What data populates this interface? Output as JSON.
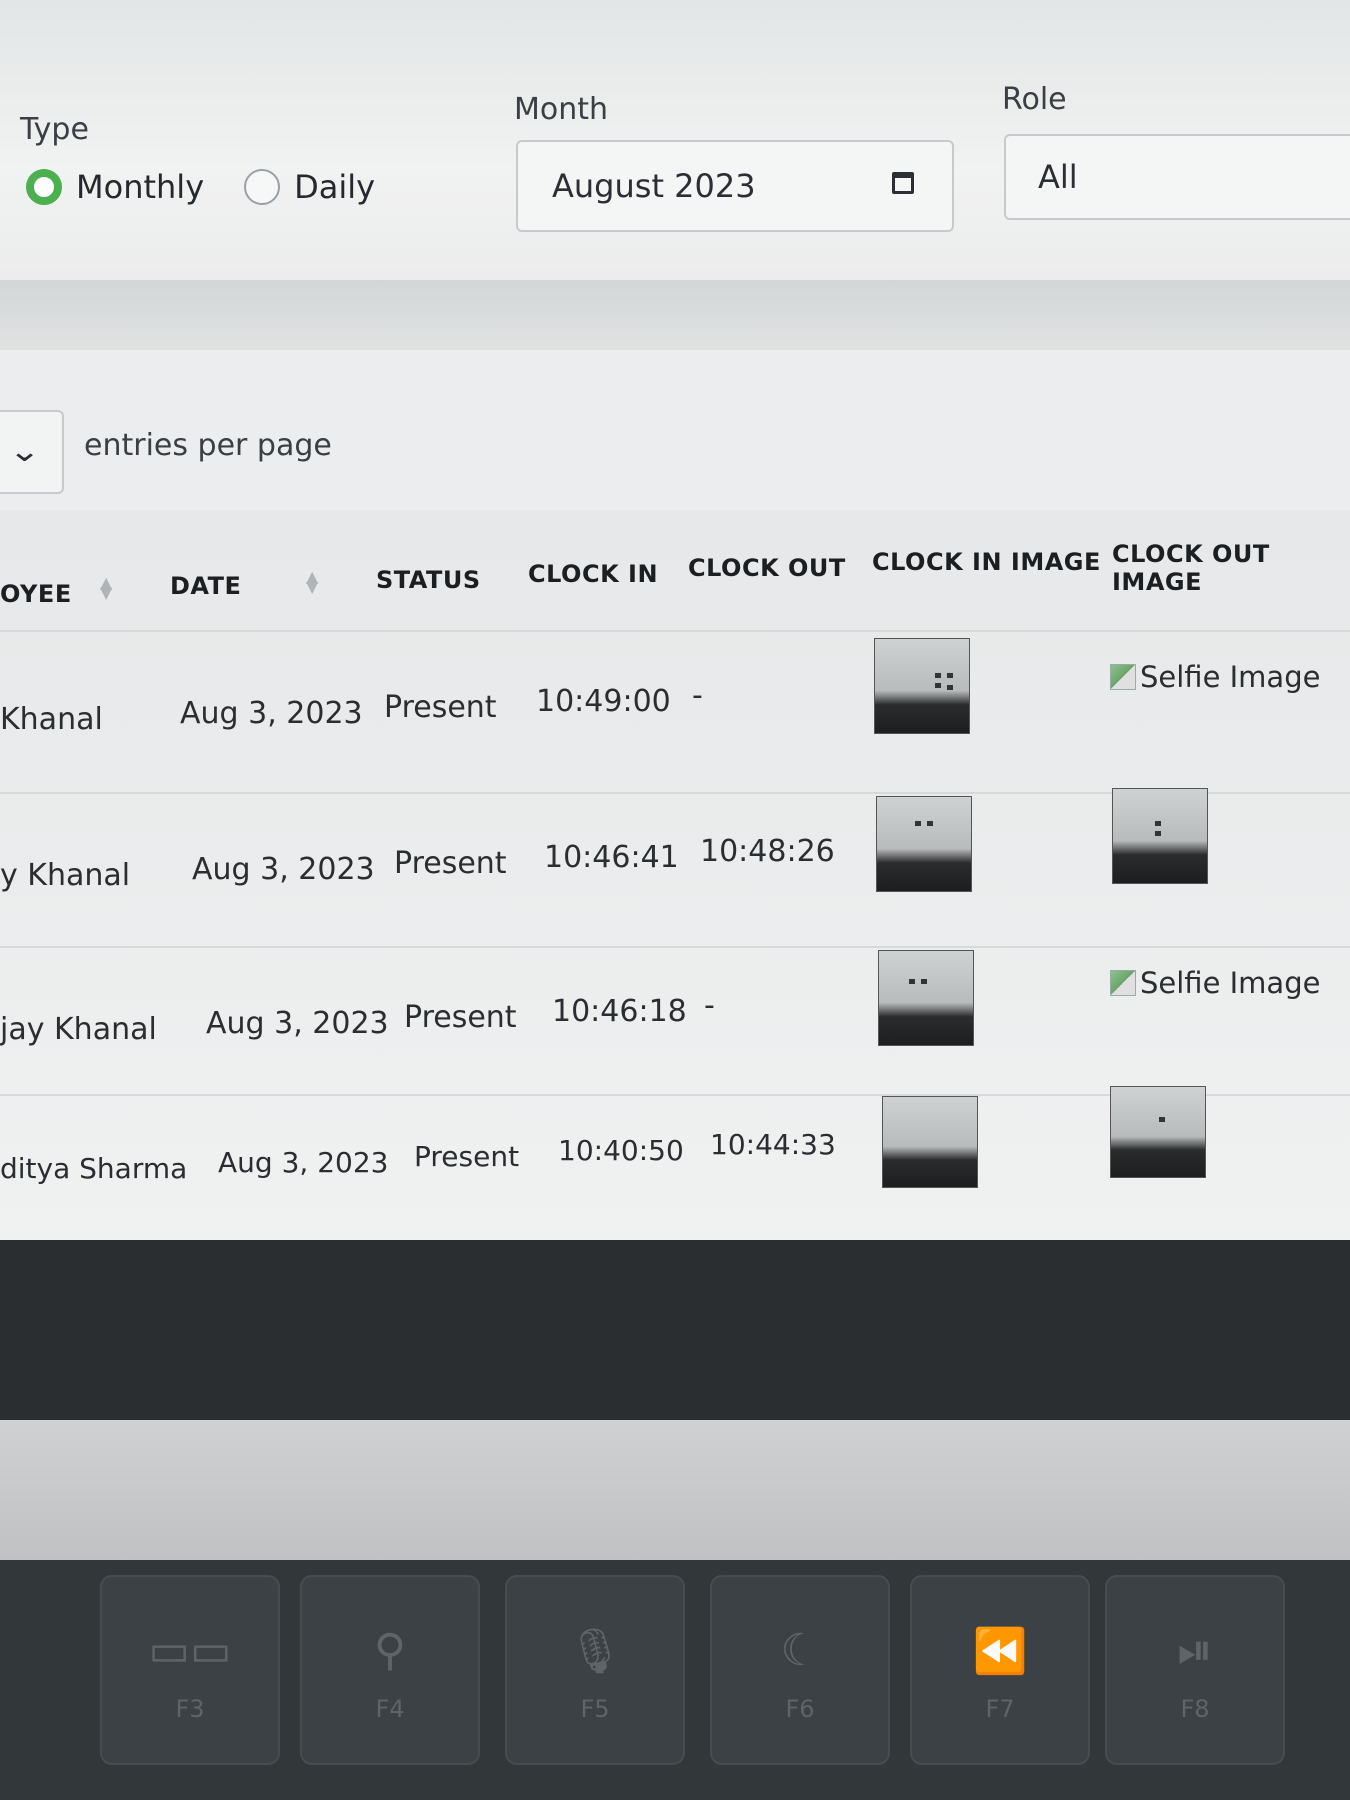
{
  "filters": {
    "type_label": "Type",
    "type_options": [
      {
        "label": "Monthly",
        "selected": true
      },
      {
        "label": "Daily",
        "selected": false
      }
    ],
    "month_label": "Month",
    "month_value": "August 2023",
    "role_label": "Role",
    "role_value": "All"
  },
  "entries": {
    "text": "entries per page"
  },
  "table": {
    "columns": [
      "OYEE",
      "DATE",
      "STATUS",
      "CLOCK IN",
      "CLOCK OUT",
      "CLOCK IN IMAGE",
      "CLOCK OUT IMAGE"
    ],
    "rows": [
      {
        "employee": "Khanal",
        "date": "Aug 3, 2023",
        "status": "Present",
        "clock_in": "10:49:00",
        "clock_out": "-",
        "clock_out_image_alt": "Selfie Image"
      },
      {
        "employee": "y Khanal",
        "date": "Aug 3, 2023",
        "status": "Present",
        "clock_in": "10:46:41",
        "clock_out": "10:48:26",
        "clock_out_image_alt": ""
      },
      {
        "employee": "jay Khanal",
        "date": "Aug 3, 2023",
        "status": "Present",
        "clock_in": "10:46:18",
        "clock_out": "-",
        "clock_out_image_alt": "Selfie Image"
      },
      {
        "employee": "ditya Sharma",
        "date": "Aug 3, 2023",
        "status": "Present",
        "clock_in": "10:40:50",
        "clock_out": "10:44:33",
        "clock_out_image_alt": ""
      }
    ]
  },
  "keyboard": {
    "keys": [
      {
        "icon": "mission-control-icon",
        "symbol": "▭▭",
        "fn": "F3"
      },
      {
        "icon": "search-icon",
        "symbol": "⚲",
        "fn": "F4"
      },
      {
        "icon": "microphone-icon",
        "symbol": "🎙",
        "fn": "F5"
      },
      {
        "icon": "moon-icon",
        "symbol": "☾",
        "fn": "F6"
      },
      {
        "icon": "rewind-icon",
        "symbol": "⏪",
        "fn": "F7"
      },
      {
        "icon": "play-pause-icon",
        "symbol": "⏯",
        "fn": "F8"
      }
    ]
  },
  "colors": {
    "radio_selected": "#4caf50"
  }
}
